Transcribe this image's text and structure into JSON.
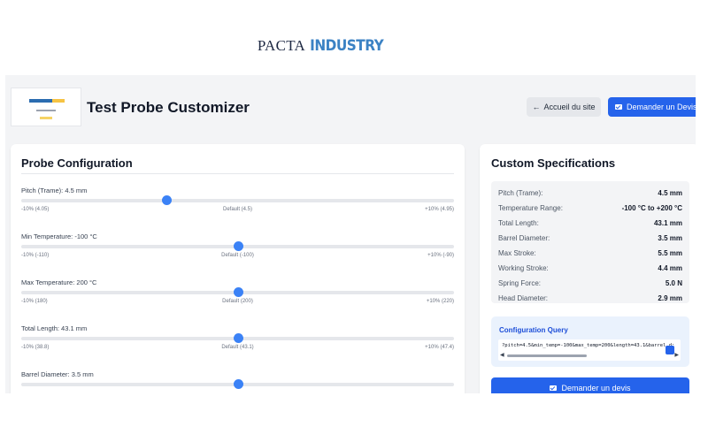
{
  "brand": {
    "name_part1": "PACTA",
    "name_part2": "INDUSTRY"
  },
  "header": {
    "title": "Test Probe Customizer",
    "home_label": "Accueil du site",
    "home_icon": "arrow-left-icon",
    "quote_label": "Demander un Devis",
    "quote_icon": "envelope-icon"
  },
  "config": {
    "title": "Probe Configuration",
    "params": [
      {
        "label": "Pitch (Trame):",
        "value": "4.5",
        "unit": "mm",
        "position": 0.336,
        "min_label": "-10% (4.05)",
        "default_label": "Default (4.5)",
        "max_label": "+10% (4.95)"
      },
      {
        "label": "Min Temperature:",
        "value": "-100",
        "unit": "°C",
        "position": 0.5,
        "min_label": "-10% (-110)",
        "default_label": "Default (-100)",
        "max_label": "+10% (-90)"
      },
      {
        "label": "Max Temperature:",
        "value": "200",
        "unit": "°C",
        "position": 0.5,
        "min_label": "-10% (180)",
        "default_label": "Default (200)",
        "max_label": "+10% (220)"
      },
      {
        "label": "Total Length:",
        "value": "43.1",
        "unit": "mm",
        "position": 0.5,
        "min_label": "-10% (38.8)",
        "default_label": "Default (43.1)",
        "max_label": "+10% (47.4)"
      },
      {
        "label": "Barrel Diameter:",
        "value": "3.5",
        "unit": "mm",
        "position": 0.5
      }
    ]
  },
  "specs": {
    "title": "Custom Specifications",
    "rows": [
      {
        "key": "Pitch (Trame):",
        "value": "4.5 mm"
      },
      {
        "key": "Temperature Range:",
        "value": "-100 °C to +200 °C"
      },
      {
        "key": "Total Length:",
        "value": "43.1 mm"
      },
      {
        "key": "Barrel Diameter:",
        "value": "3.5 mm"
      },
      {
        "key": "Max Stroke:",
        "value": "5.5 mm"
      },
      {
        "key": "Working Stroke:",
        "value": "4.4 mm"
      },
      {
        "key": "Spring Force:",
        "value": "5.0 N"
      },
      {
        "key": "Head Diameter:",
        "value": "2.9 mm"
      }
    ]
  },
  "query": {
    "title": "Configuration Query",
    "text": "?pitch=4.5&min_temp=-100&max_temp=200&length=43.1&barrel_d:",
    "copy_icon": "copy-icon"
  },
  "cta": {
    "label": "Demander un devis",
    "icon": "envelope-icon"
  },
  "colors": {
    "accent": "#2563eb",
    "brand_blue": "#3b82c4",
    "slider_thumb": "#3b82f6"
  }
}
